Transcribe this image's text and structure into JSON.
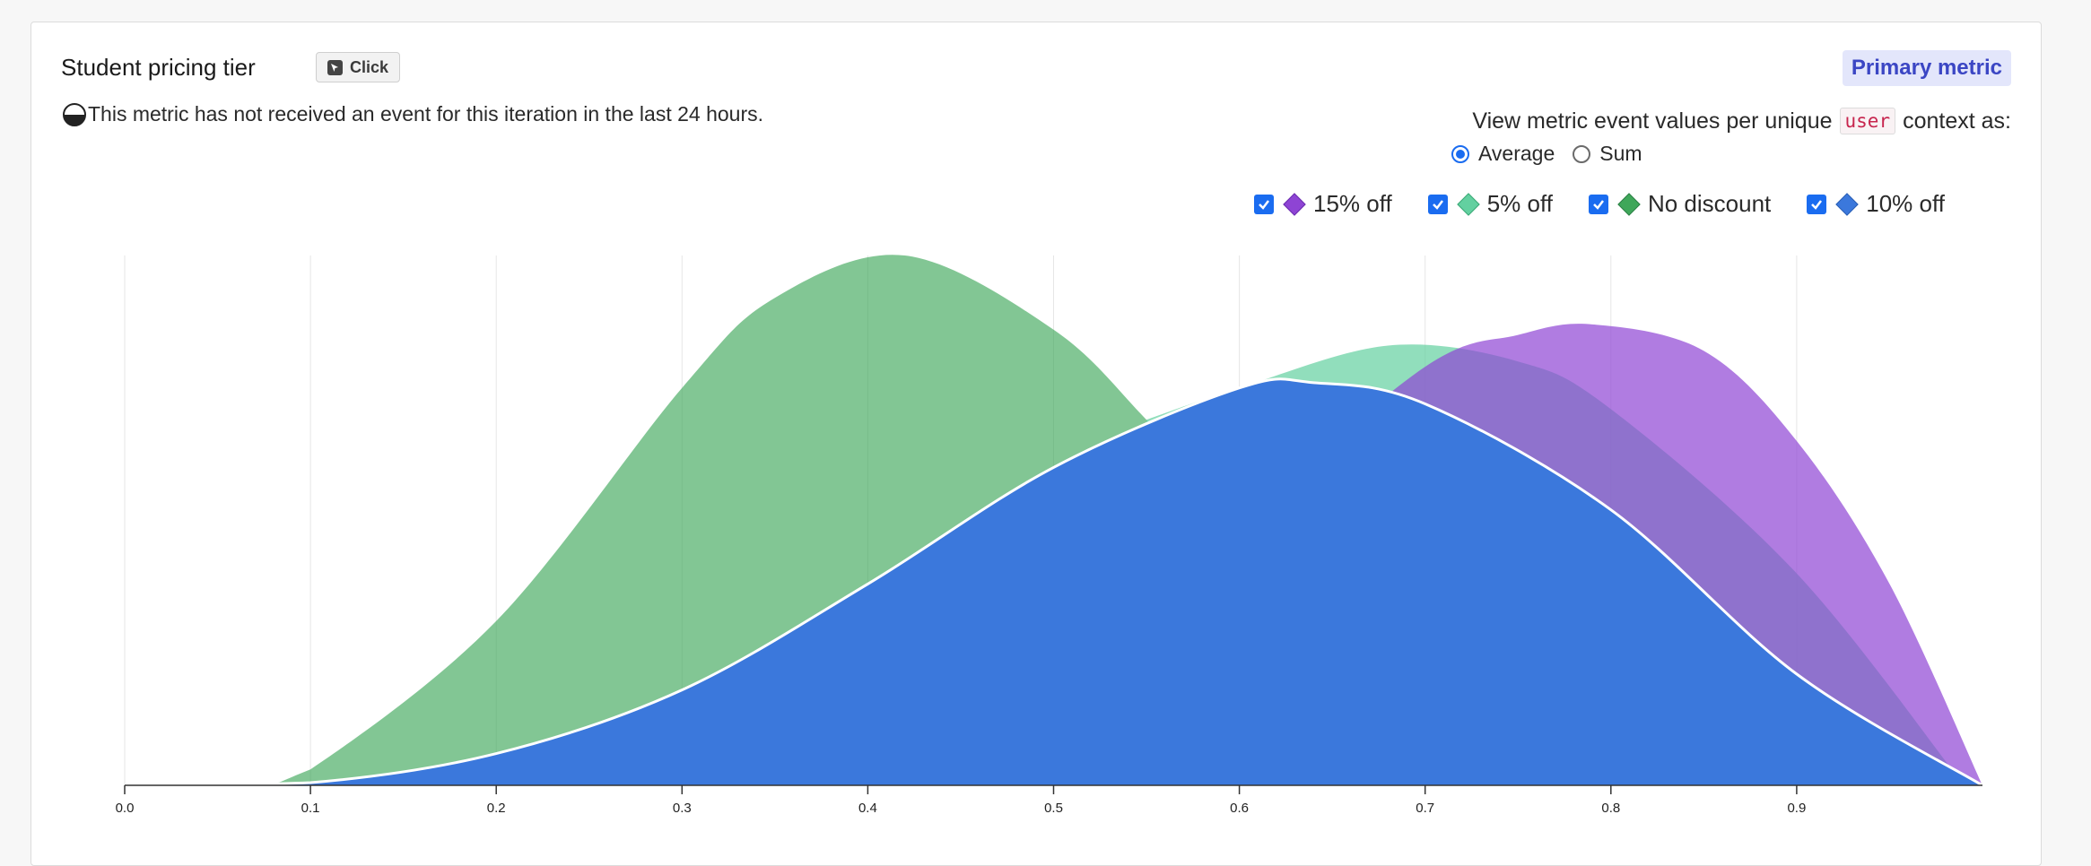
{
  "panel": {
    "title": "Student pricing tier",
    "event_button_label": "Click",
    "badge": "Primary metric",
    "warning": "This metric has not received an event for this iteration in the last 24 hours.",
    "view_prefix": "View metric event values per unique",
    "context_key": "user",
    "view_suffix": "context as:",
    "radio_options": [
      {
        "label": "Average",
        "checked": true
      },
      {
        "label": "Sum",
        "checked": false
      }
    ]
  },
  "legend": [
    {
      "label": "15% off",
      "color": "#8e44d4",
      "checked": true
    },
    {
      "label": "5% off",
      "color": "#63d0a0",
      "checked": true
    },
    {
      "label": "No discount",
      "color": "#3fa75a",
      "checked": true
    },
    {
      "label": "10% off",
      "color": "#3b78dc",
      "checked": true
    }
  ],
  "chart_data": {
    "type": "area",
    "title": "",
    "xlabel": "",
    "ylabel": "",
    "xlim": [
      0,
      1
    ],
    "x_ticks": [
      "0.0",
      "0.1",
      "0.2",
      "0.3",
      "0.4",
      "0.5",
      "0.6",
      "0.7",
      "0.8",
      "0.9"
    ],
    "grid": "vertical",
    "legend_placement": "top-right",
    "series": [
      {
        "name": "No discount",
        "color": "#3fa75a",
        "opacity": 0.65,
        "x": [
          0.0,
          0.07,
          0.1,
          0.2,
          0.3,
          0.35,
          0.42,
          0.5,
          0.55,
          0.6
        ],
        "y": [
          0,
          0,
          0.03,
          0.31,
          0.75,
          0.92,
          1.0,
          0.86,
          0.69,
          0.5
        ]
      },
      {
        "name": "5% off",
        "color": "#63d0a0",
        "opacity": 0.7,
        "x": [
          0.55,
          0.6,
          0.68,
          0.75,
          0.8,
          0.9,
          0.99
        ],
        "y": [
          0.69,
          0.75,
          0.83,
          0.8,
          0.71,
          0.4,
          0.0
        ]
      },
      {
        "name": "15% off",
        "color": "#8e44d4",
        "opacity": 0.7,
        "x": [
          0.6,
          0.7,
          0.75,
          0.79,
          0.85,
          0.9,
          0.95,
          1.0
        ],
        "y": [
          0.5,
          0.79,
          0.85,
          0.87,
          0.82,
          0.65,
          0.38,
          0.0
        ]
      },
      {
        "name": "10% off",
        "color": "#3b78dc",
        "opacity": 1.0,
        "x": [
          0.0,
          0.1,
          0.2,
          0.3,
          0.4,
          0.5,
          0.6,
          0.64,
          0.7,
          0.8,
          0.9,
          1.0
        ],
        "y": [
          0,
          0.005,
          0.06,
          0.18,
          0.38,
          0.6,
          0.75,
          0.76,
          0.72,
          0.52,
          0.21,
          0.0
        ]
      }
    ]
  }
}
